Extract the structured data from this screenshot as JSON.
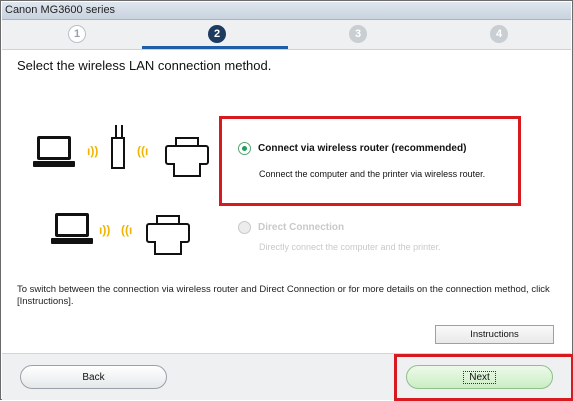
{
  "window": {
    "title": "Canon MG3600 series"
  },
  "steps": [
    {
      "label": "1",
      "state": "done"
    },
    {
      "label": "2",
      "state": "active"
    },
    {
      "label": "3",
      "state": "pending"
    },
    {
      "label": "4",
      "state": "pending"
    }
  ],
  "page": {
    "heading": "Select the wireless LAN connection method."
  },
  "options": {
    "router": {
      "title": "Connect via wireless router (recommended)",
      "description": "Connect the computer and the printer via wireless router.",
      "selected": true
    },
    "direct": {
      "title": "Direct Connection",
      "description": "Directly connect the computer and the printer.",
      "enabled": false
    }
  },
  "info": {
    "text": "To switch between the connection via wireless router and Direct Connection or for more details on the connection method, click [Instructions]."
  },
  "buttons": {
    "instructions": "Instructions",
    "back": "Back",
    "next": "Next"
  },
  "colors": {
    "highlight": "#d71920",
    "selected_radio": "#1fa05a",
    "step_active": "#1d3a5f",
    "wireless_waves": "#f0b400"
  },
  "icons": {
    "laptop": "laptop-icon",
    "router": "router-icon",
    "printer": "printer-icon",
    "waves": "wireless-waves-icon"
  }
}
